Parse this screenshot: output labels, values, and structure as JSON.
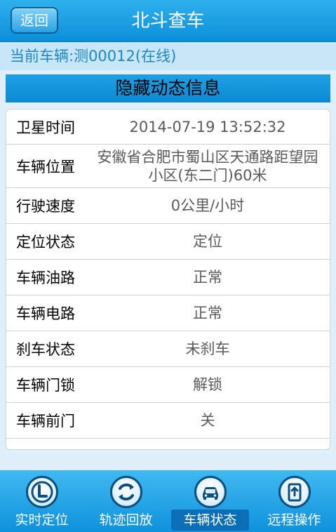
{
  "header": {
    "back_label": "返回",
    "title": "北斗查车"
  },
  "vehicle_bar": {
    "text": "当前车辆:测00012(在线)"
  },
  "section": {
    "title": "隐藏动态信息"
  },
  "rows": [
    {
      "label": "卫星时间",
      "value": "2014-07-19 13:52:32"
    },
    {
      "label": "车辆位置",
      "value": "安徽省合肥市蜀山区天通路距望园小区(东二门)60米"
    },
    {
      "label": "行驶速度",
      "value": "0公里/小时"
    },
    {
      "label": "定位状态",
      "value": "定位"
    },
    {
      "label": "车辆油路",
      "value": "正常"
    },
    {
      "label": "车辆电路",
      "value": "正常"
    },
    {
      "label": "刹车状态",
      "value": "未刹车"
    },
    {
      "label": "车辆门锁",
      "value": "解锁"
    },
    {
      "label": "车辆前门",
      "value": "关"
    }
  ],
  "tabs": [
    {
      "label": "实时定位",
      "icon": "location-l-icon"
    },
    {
      "label": "轨迹回放",
      "icon": "playback-arrows-icon"
    },
    {
      "label": "车辆状态",
      "icon": "car-icon",
      "active": true
    },
    {
      "label": "远程操作",
      "icon": "remote-phone-icon"
    }
  ],
  "colors": {
    "brand_blue": "#0b8fd8",
    "vehicle_text": "#1d86c8",
    "value_gray": "#5a5a5a"
  }
}
